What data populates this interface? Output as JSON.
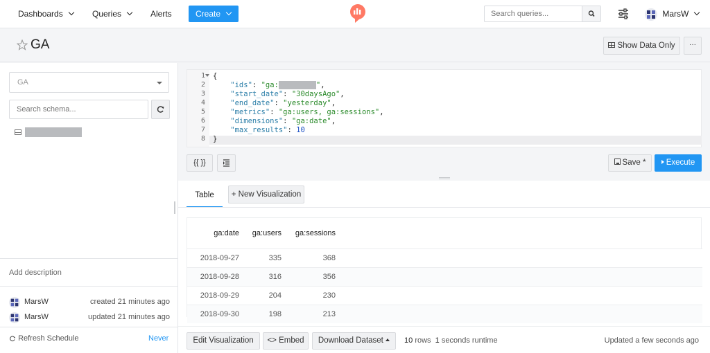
{
  "nav": {
    "dashboards": "Dashboards",
    "queries": "Queries",
    "alerts": "Alerts",
    "create": "Create",
    "search_placeholder": "Search queries...",
    "user": "MarsW"
  },
  "header": {
    "title": "GA",
    "show_data_only": "Show Data Only",
    "more": "···"
  },
  "sidebar": {
    "data_source": "GA",
    "schema_placeholder": "Search schema...",
    "add_description": "Add description",
    "history": [
      {
        "user": "MarsW",
        "action": "created 21 minutes ago"
      },
      {
        "user": "MarsW",
        "action": "updated 21 minutes ago"
      }
    ],
    "refresh_schedule": "Refresh Schedule",
    "refresh_value": "Never"
  },
  "editor": {
    "line_numbers": [
      "1",
      "2",
      "3",
      "4",
      "5",
      "6",
      "7",
      "8"
    ],
    "lines": [
      {
        "parts": [
          [
            "pn",
            "{"
          ]
        ]
      },
      {
        "parts": [
          [
            "key",
            "    \"ids\""
          ],
          [
            "pn",
            ": "
          ],
          [
            "str",
            "\"ga:"
          ],
          [
            "redact",
            "         "
          ],
          [
            "str",
            "\""
          ],
          [
            "pn",
            ","
          ]
        ]
      },
      {
        "parts": [
          [
            "key",
            "    \"start_date\""
          ],
          [
            "pn",
            ": "
          ],
          [
            "str",
            "\"30daysAgo\""
          ],
          [
            "pn",
            ","
          ]
        ]
      },
      {
        "parts": [
          [
            "key",
            "    \"end_date\""
          ],
          [
            "pn",
            ": "
          ],
          [
            "str",
            "\"yesterday\""
          ],
          [
            "pn",
            ","
          ]
        ]
      },
      {
        "parts": [
          [
            "key",
            "    \"metrics\""
          ],
          [
            "pn",
            ": "
          ],
          [
            "str",
            "\"ga:users, ga:sessions\""
          ],
          [
            "pn",
            ","
          ]
        ]
      },
      {
        "parts": [
          [
            "key",
            "    \"dimensions\""
          ],
          [
            "pn",
            ": "
          ],
          [
            "str",
            "\"ga:date\""
          ],
          [
            "pn",
            ","
          ]
        ]
      },
      {
        "parts": [
          [
            "key",
            "    \"max_results\""
          ],
          [
            "pn",
            ": "
          ],
          [
            "num",
            "10"
          ]
        ]
      },
      {
        "parts": [
          [
            "pn",
            "}"
          ]
        ]
      }
    ],
    "format_label": "{{ }}",
    "save_label": "Save *",
    "execute_label": "Execute"
  },
  "results": {
    "tab_table": "Table",
    "tab_new_viz": "New Visualization",
    "columns": [
      "ga:date",
      "ga:users",
      "ga:sessions"
    ],
    "rows": [
      [
        "2018-09-27",
        "335",
        "368"
      ],
      [
        "2018-09-28",
        "316",
        "356"
      ],
      [
        "2018-09-29",
        "204",
        "230"
      ],
      [
        "2018-09-30",
        "198",
        "213"
      ]
    ],
    "edit_viz": "Edit Visualization",
    "embed": "Embed",
    "download": "Download Dataset",
    "rows_count": "10",
    "rows_label": "rows",
    "runtime_value": "1",
    "runtime_label": "seconds runtime",
    "updated": "Updated a few seconds ago"
  },
  "colors": {
    "primary": "#2196f3",
    "brand": "#ff7964"
  }
}
